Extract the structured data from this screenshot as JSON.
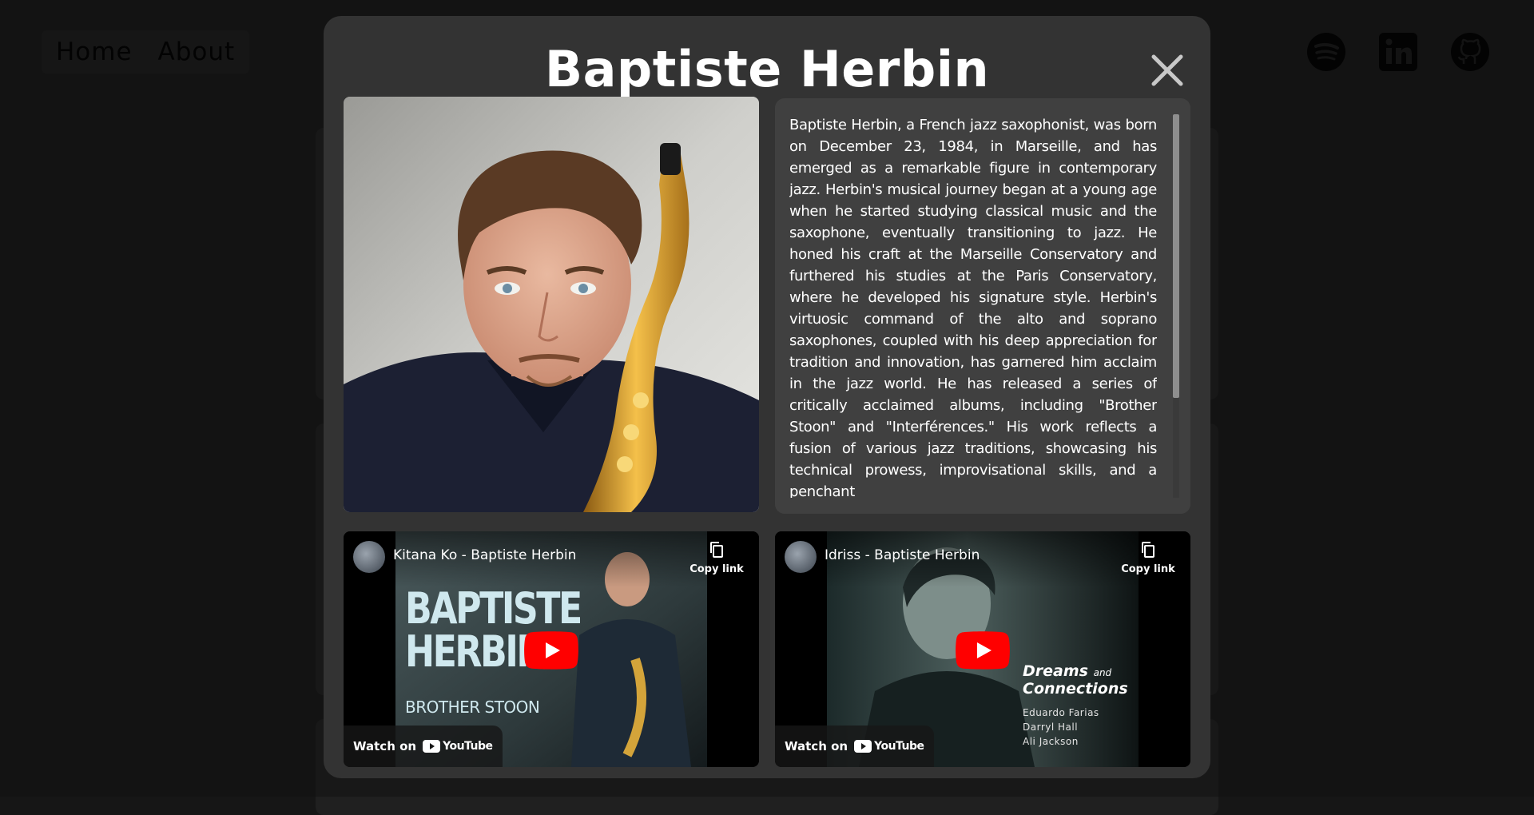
{
  "nav": {
    "items": [
      {
        "label": "Home"
      },
      {
        "label": "About"
      }
    ]
  },
  "social": {
    "icons": [
      "spotify-icon",
      "linkedin-icon",
      "github-icon"
    ]
  },
  "modal": {
    "title": "Baptiste Herbin",
    "bio": "Baptiste Herbin, a French jazz saxophonist, was born on December 23, 1984, in Marseille, and has emerged as a remarkable figure in contemporary jazz. Herbin's musical journey began at a young age when he started studying classical music and the saxophone, eventually transitioning to jazz. He honed his craft at the Marseille Conservatory and furthered his studies at the Paris Conservatory, where he developed his signature style. Herbin's virtuosic command of the alto and soprano saxophones, coupled with his deep appreciation for tradition and innovation, has garnered him acclaim in the jazz world. He has released a series of critically acclaimed albums, including \"Brother Stoon\" and \"Interférences.\" His work reflects a fusion of various jazz traditions, showcasing his technical prowess, improvisational skills, and a penchant",
    "videos": [
      {
        "title": "Kitana Ko - Baptiste Herbin",
        "copy_link": "Copy link",
        "watch_on": "Watch on",
        "youtube": "YouTube",
        "thumb_line1": "BAPTISTE",
        "thumb_line2": "HERBIN",
        "thumb_line3": "BROTHER STOON"
      },
      {
        "title": "Idriss - Baptiste Herbin",
        "copy_link": "Copy link",
        "watch_on": "Watch on",
        "youtube": "YouTube",
        "thumb_title1": "Dreams",
        "thumb_title_and": "and",
        "thumb_title2": "Connections",
        "thumb_credits": [
          "Eduardo Farias",
          "Darryl Hall",
          "Ali Jackson"
        ]
      }
    ]
  },
  "colors": {
    "modal_bg": "#333333",
    "bio_bg": "#404040",
    "youtube_red": "#ff0000"
  }
}
